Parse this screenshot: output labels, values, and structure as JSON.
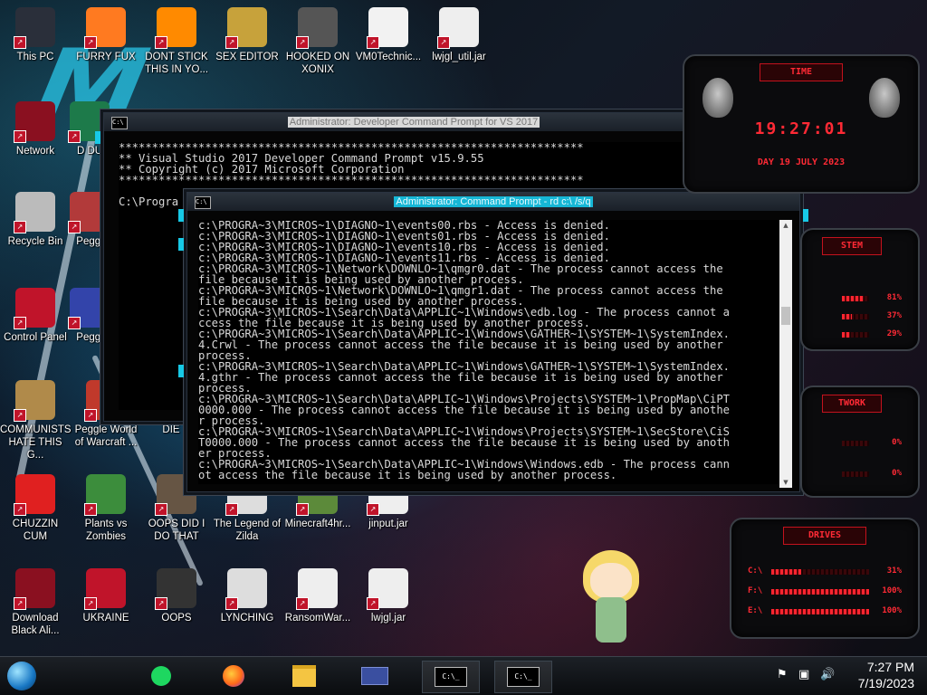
{
  "desktop": {
    "icons": [
      {
        "label": "This PC"
      },
      {
        "label": "FURRY FUX"
      },
      {
        "label": "DONT STICK THIS IN YO..."
      },
      {
        "label": "SEX EDITOR"
      },
      {
        "label": "HOOKED ON XONIX"
      },
      {
        "label": "VM0Technic..."
      },
      {
        "label": "lwjgl_util.jar"
      },
      {
        "label": "Network"
      },
      {
        "label": "Recycle Bin"
      },
      {
        "label": "Peggl"
      },
      {
        "label": "Control Panel"
      },
      {
        "label": "Peggl"
      },
      {
        "label": "COMMUNISTS HATE THIS G..."
      },
      {
        "label": "Peggle World of Warcraft ..."
      },
      {
        "label": "DIE"
      },
      {
        "label": "CHUZZIN CUM"
      },
      {
        "label": "Plants vs Zombies"
      },
      {
        "label": "OOPS DID I DO THAT"
      },
      {
        "label": "The Legend of Zilda"
      },
      {
        "label": "Minecraft4hr..."
      },
      {
        "label": "jinput.jar"
      },
      {
        "label": "Download Black Ali..."
      },
      {
        "label": "UKRAINE"
      },
      {
        "label": "OOPS"
      },
      {
        "label": "LYNCHING"
      },
      {
        "label": "RansomWar..."
      },
      {
        "label": "lwjgl.jar"
      },
      {
        "label": "D DU"
      }
    ]
  },
  "window_vs": {
    "title": "Administrator: Developer Command Prompt for VS 2017",
    "lines": [
      "**********************************************************************",
      "** Visual Studio 2017 Developer Command Prompt v15.9.55",
      "** Copyright (c) 2017 Microsoft Corporation",
      "**********************************************************************",
      "",
      "C:\\Progra"
    ]
  },
  "window_cmd": {
    "title": "Administrator: Command Prompt - rd  c:\\ /s/q",
    "lines": [
      "c:\\PROGRA~3\\MICROS~1\\DIAGNO~1\\events00.rbs - Access is denied.",
      "c:\\PROGRA~3\\MICROS~1\\DIAGNO~1\\events01.rbs - Access is denied.",
      "c:\\PROGRA~3\\MICROS~1\\DIAGNO~1\\events10.rbs - Access is denied.",
      "c:\\PROGRA~3\\MICROS~1\\DIAGNO~1\\events11.rbs - Access is denied.",
      "c:\\PROGRA~3\\MICROS~1\\Network\\DOWNLO~1\\qmgr0.dat - The process cannot access the",
      "file because it is being used by another process.",
      "c:\\PROGRA~3\\MICROS~1\\Network\\DOWNLO~1\\qmgr1.dat - The process cannot access the",
      "file because it is being used by another process.",
      "c:\\PROGRA~3\\MICROS~1\\Search\\Data\\APPLIC~1\\Windows\\edb.log - The process cannot a",
      "ccess the file because it is being used by another process.",
      "c:\\PROGRA~3\\MICROS~1\\Search\\Data\\APPLIC~1\\Windows\\GATHER~1\\SYSTEM~1\\SystemIndex.",
      "4.Crwl - The process cannot access the file because it is being used by another",
      "process.",
      "c:\\PROGRA~3\\MICROS~1\\Search\\Data\\APPLIC~1\\Windows\\GATHER~1\\SYSTEM~1\\SystemIndex.",
      "4.gthr - The process cannot access the file because it is being used by another",
      "process.",
      "c:\\PROGRA~3\\MICROS~1\\Search\\Data\\APPLIC~1\\Windows\\Projects\\SYSTEM~1\\PropMap\\CiPT",
      "0000.000 - The process cannot access the file because it is being used by anothe",
      "r process.",
      "c:\\PROGRA~3\\MICROS~1\\Search\\Data\\APPLIC~1\\Windows\\Projects\\SYSTEM~1\\SecStore\\CiS",
      "T0000.000 - The process cannot access the file because it is being used by anoth",
      "er process.",
      "c:\\PROGRA~3\\MICROS~1\\Search\\Data\\APPLIC~1\\Windows\\Windows.edb - The process cann",
      "ot access the file because it is being used by another process."
    ]
  },
  "widgets": {
    "time": {
      "header": "TIME",
      "clock": "19:27:01",
      "date": "DAY 19 JULY 2023"
    },
    "system": {
      "header": "STEM",
      "rows": [
        {
          "label": "",
          "pct": "81%",
          "value": 0.81
        },
        {
          "label": "",
          "pct": "37%",
          "value": 0.37
        },
        {
          "label": "",
          "pct": "29%",
          "value": 0.29
        }
      ]
    },
    "network": {
      "header": "TWORK",
      "rows": [
        {
          "pct": "0%",
          "value": 0.0
        },
        {
          "pct": "0%",
          "value": 0.0
        }
      ]
    },
    "drives": {
      "header": "DRIVES",
      "rows": [
        {
          "label": "C:\\",
          "pct": "31%",
          "value": 0.31
        },
        {
          "label": "F:\\",
          "pct": "100%",
          "value": 1.0
        },
        {
          "label": "E:\\",
          "pct": "100%",
          "value": 1.0
        }
      ]
    }
  },
  "taskbar": {
    "clock_time": "7:27 PM",
    "clock_date": "7/19/2023",
    "cmd_button_1": "C:\\_",
    "cmd_button_2": "C:\\_"
  },
  "colors": {
    "accent_cyan": "#17c9e6",
    "led_red": "#ff2a35"
  }
}
